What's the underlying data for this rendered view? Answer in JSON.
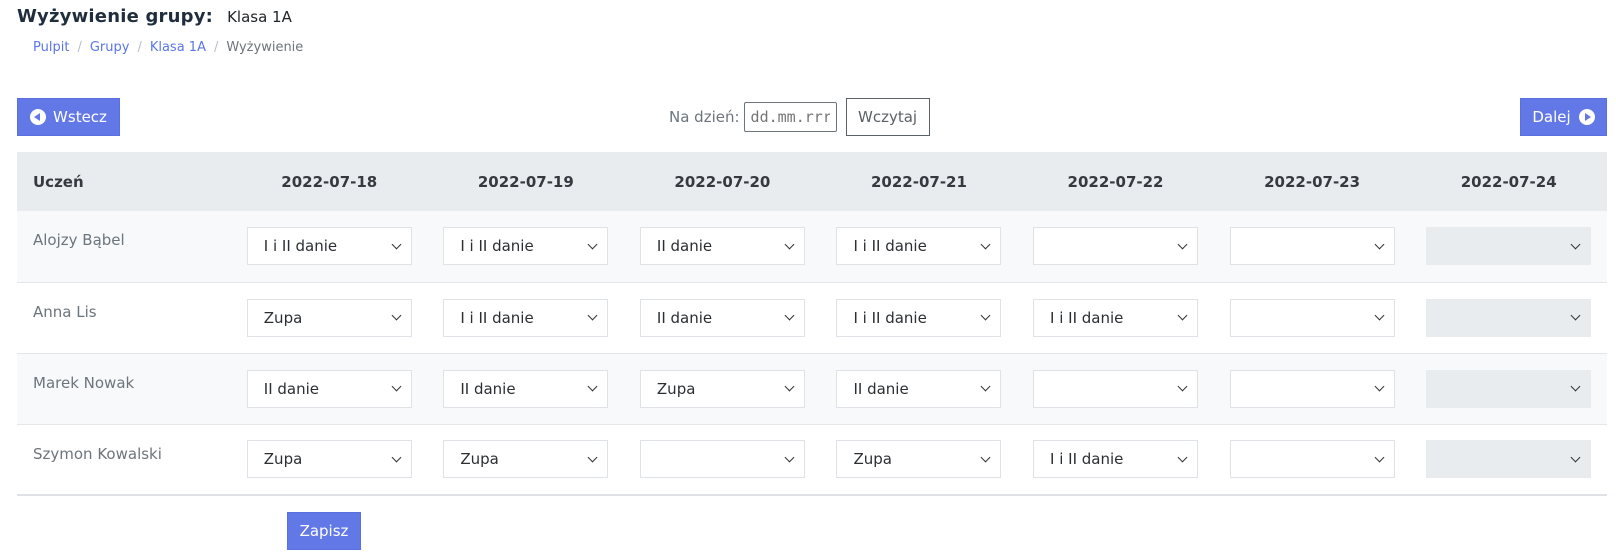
{
  "header": {
    "title": "Wyżywienie grupy:",
    "subtitle": "Klasa 1A"
  },
  "breadcrumb": [
    {
      "label": "Pulpit",
      "link": true
    },
    {
      "label": "Grupy",
      "link": true
    },
    {
      "label": "Klasa 1A",
      "link": true
    },
    {
      "label": "Wyżywienie",
      "link": false
    }
  ],
  "toolbar": {
    "back_label": "Wstecz",
    "next_label": "Dalej",
    "date_label": "Na dzień:",
    "date_placeholder": "dd.mm.rrrr",
    "load_label": "Wczytaj"
  },
  "table": {
    "student_header": "Uczeń",
    "dates": [
      "2022-07-18",
      "2022-07-19",
      "2022-07-20",
      "2022-07-21",
      "2022-07-22",
      "2022-07-23",
      "2022-07-24"
    ],
    "disabled_columns": [
      6
    ],
    "rows": [
      {
        "student": "Alojzy Bąbel",
        "meals": [
          "I i II danie",
          "I i II danie",
          "II danie",
          "I i II danie",
          "",
          "",
          ""
        ]
      },
      {
        "student": "Anna Lis",
        "meals": [
          "Zupa",
          "I i II danie",
          "II danie",
          "I i II danie",
          "I i II danie",
          "",
          ""
        ]
      },
      {
        "student": "Marek Nowak",
        "meals": [
          "II danie",
          "II danie",
          "Zupa",
          "II danie",
          "",
          "",
          ""
        ]
      },
      {
        "student": "Szymon Kowalski",
        "meals": [
          "Zupa",
          "Zupa",
          "",
          "Zupa",
          "I i II danie",
          "",
          ""
        ]
      }
    ]
  },
  "save_label": "Zapisz",
  "colors": {
    "primary": "#6378e7",
    "link": "#5a76e8",
    "header_bg": "#e9ecef"
  },
  "icons": {
    "back": "arrow-circle-left-icon",
    "next": "arrow-circle-right-icon",
    "select": "chevron-down-icon"
  }
}
